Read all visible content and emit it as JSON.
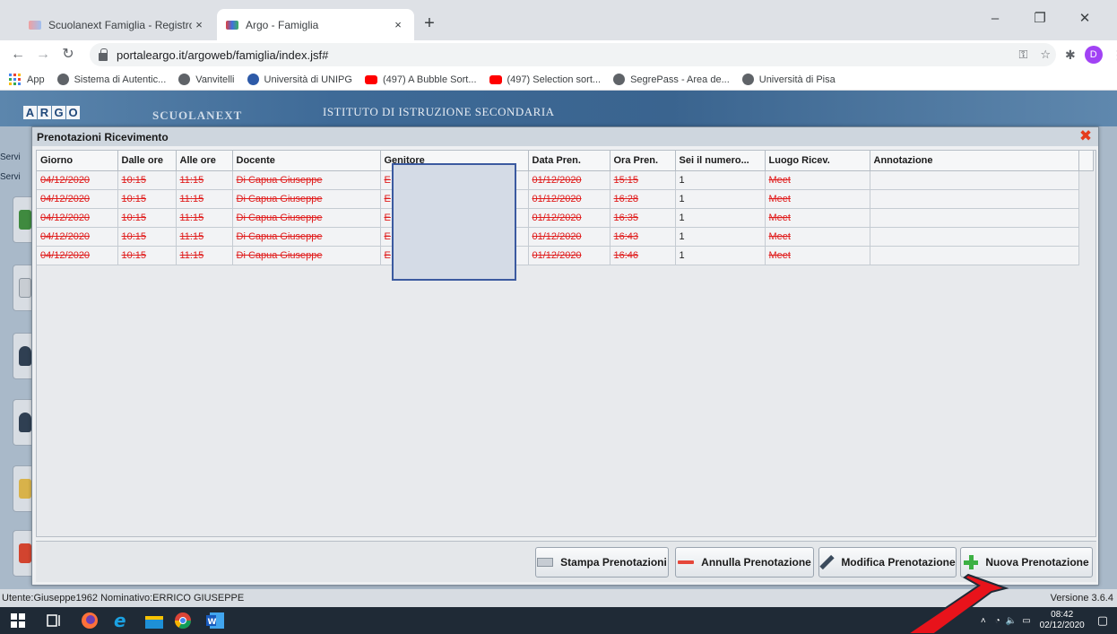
{
  "browser": {
    "tabs": [
      {
        "title": "Scuolanext Famiglia - Registro El",
        "close": "×",
        "active": false
      },
      {
        "title": "Argo - Famiglia",
        "close": "×",
        "active": true
      }
    ],
    "new_tab": "+",
    "window_controls": {
      "minimize": "–",
      "restore": "❐",
      "close": "✕"
    },
    "url": "portaleargo.it/argoweb/famiglia/index.jsf#",
    "profile_initial": "D",
    "bookmarks": [
      {
        "label": "App",
        "icon": "apps-icon"
      },
      {
        "label": "Sistema di Autentic...",
        "icon": "globe-icon"
      },
      {
        "label": "Vanvitelli",
        "icon": "globe-icon"
      },
      {
        "label": "Università di UNIPG",
        "icon": "unipg-icon"
      },
      {
        "label": "(497) A Bubble Sort...",
        "icon": "youtube-icon"
      },
      {
        "label": "(497) Selection sort...",
        "icon": "youtube-icon"
      },
      {
        "label": "SegrePass - Area de...",
        "icon": "globe-icon"
      },
      {
        "label": "Università di Pisa",
        "icon": "globe-icon"
      }
    ]
  },
  "app": {
    "logo_letters": [
      "A",
      "R",
      "G",
      "O"
    ],
    "product": "SCUOLANEXT",
    "school": "ISTITUTO DI ISTRUZIONE SECONDARIA",
    "side_fragments": [
      "Servi",
      "Servi"
    ],
    "status": {
      "user": "Utente:Giuseppe1962 Nominativo:ERRICO GIUSEPPE",
      "version": "Versione 3.6.4"
    }
  },
  "dialog": {
    "title": "Prenotazioni Ricevimento",
    "close": "✖",
    "columns": [
      "Giorno",
      "Dalle ore",
      "Alle ore",
      "Docente",
      "Genitore",
      "Data Pren.",
      "Ora Pren.",
      "Sei il numero...",
      "Luogo Ricev.",
      "Annotazione"
    ],
    "rows": [
      [
        "04/12/2020",
        "10:15",
        "11:15",
        "Di Capua Giuseppe",
        "E",
        "01/12/2020",
        "15:15",
        "1",
        "Meet",
        ""
      ],
      [
        "04/12/2020",
        "10:15",
        "11:15",
        "Di Capua Giuseppe",
        "E",
        "01/12/2020",
        "16:28",
        "1",
        "Meet",
        ""
      ],
      [
        "04/12/2020",
        "10:15",
        "11:15",
        "Di Capua Giuseppe",
        "E",
        "01/12/2020",
        "16:35",
        "1",
        "Meet",
        ""
      ],
      [
        "04/12/2020",
        "10:15",
        "11:15",
        "Di Capua Giuseppe",
        "E",
        "01/12/2020",
        "16:43",
        "1",
        "Meet",
        ""
      ],
      [
        "04/12/2020",
        "10:15",
        "11:15",
        "Di Capua Giuseppe",
        "E",
        "01/12/2020",
        "16:46",
        "1",
        "Meet",
        ""
      ]
    ],
    "buttons": {
      "print": "Stampa Prenotazioni",
      "cancel": "Annulla Prenotazione",
      "edit": "Modifica Prenotazione",
      "new": "Nuova Prenotazione"
    }
  },
  "taskbar": {
    "time": "08:42",
    "date": "02/12/2020"
  },
  "colors": {
    "strike_text": "#e01b1b",
    "arrow": "#e8131b",
    "dialog_close": "#e53c1d"
  }
}
